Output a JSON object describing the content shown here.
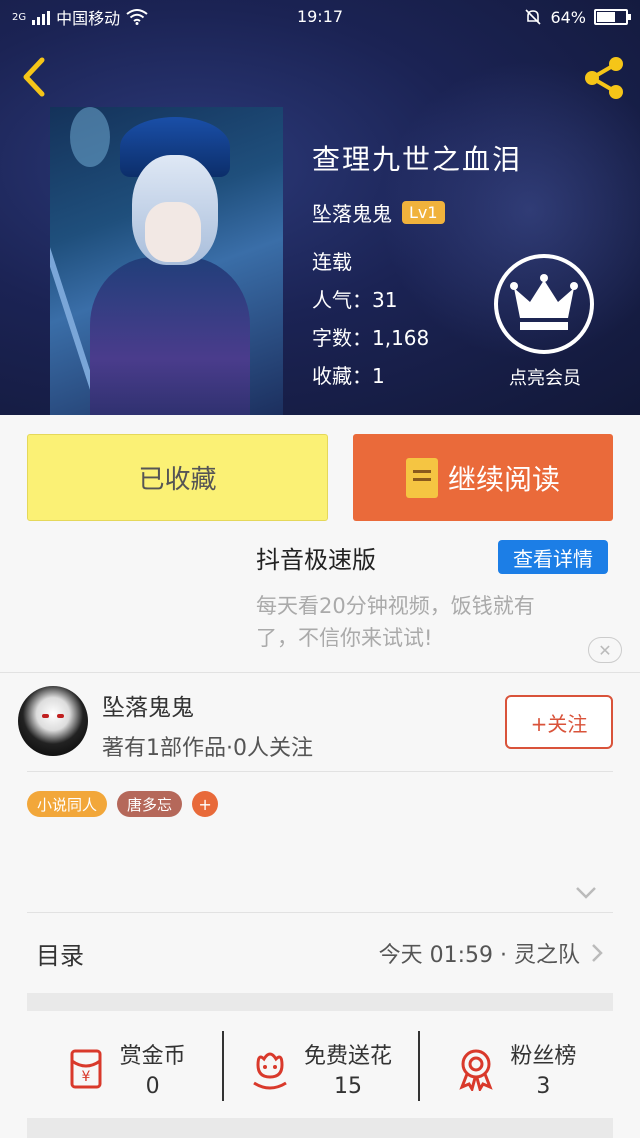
{
  "status_bar": {
    "carrier": "中国移动",
    "network": "2G",
    "time": "19:17",
    "battery": "64%",
    "battery_level": 0.64
  },
  "book": {
    "title": "查理九世之血泪",
    "author": "坠落鬼鬼",
    "author_level": "Lv1",
    "status": "连载",
    "popularity_label": "人气：",
    "popularity": "31",
    "words_label": "字数：",
    "words": "1,168",
    "favorites_label": "收藏：",
    "favorites": "1",
    "vip_label": "点亮会员"
  },
  "actions": {
    "collected_label": "已收藏",
    "continue_label": "继续阅读"
  },
  "ad": {
    "title": "抖音极速版",
    "button": "查看详情",
    "line1": "每天看20分钟视频，饭钱就有",
    "line2": "了，不信你来试试!",
    "close": "✕"
  },
  "author_card": {
    "name": "坠落鬼鬼",
    "stats": "著有1部作品·0人关注",
    "follow_label": "+关注"
  },
  "tags": [
    {
      "label": "小说同人"
    },
    {
      "label": "唐多忘"
    },
    {
      "label": "+"
    }
  ],
  "catalog": {
    "label": "目录",
    "update": "今天 01:59 · 灵之队"
  },
  "stats": [
    {
      "label": "赏金币",
      "value": "0",
      "icon": "red-envelope-icon"
    },
    {
      "label": "免费送花",
      "value": "15",
      "icon": "flower-icon"
    },
    {
      "label": "粉丝榜",
      "value": "3",
      "icon": "medal-icon"
    }
  ],
  "colors": {
    "accent_orange": "#ea6a3a",
    "collected_yellow": "#fbf175",
    "ad_blue": "#1c7ee6",
    "level_badge": "#f0b23c",
    "follow_red": "#d9533a"
  }
}
